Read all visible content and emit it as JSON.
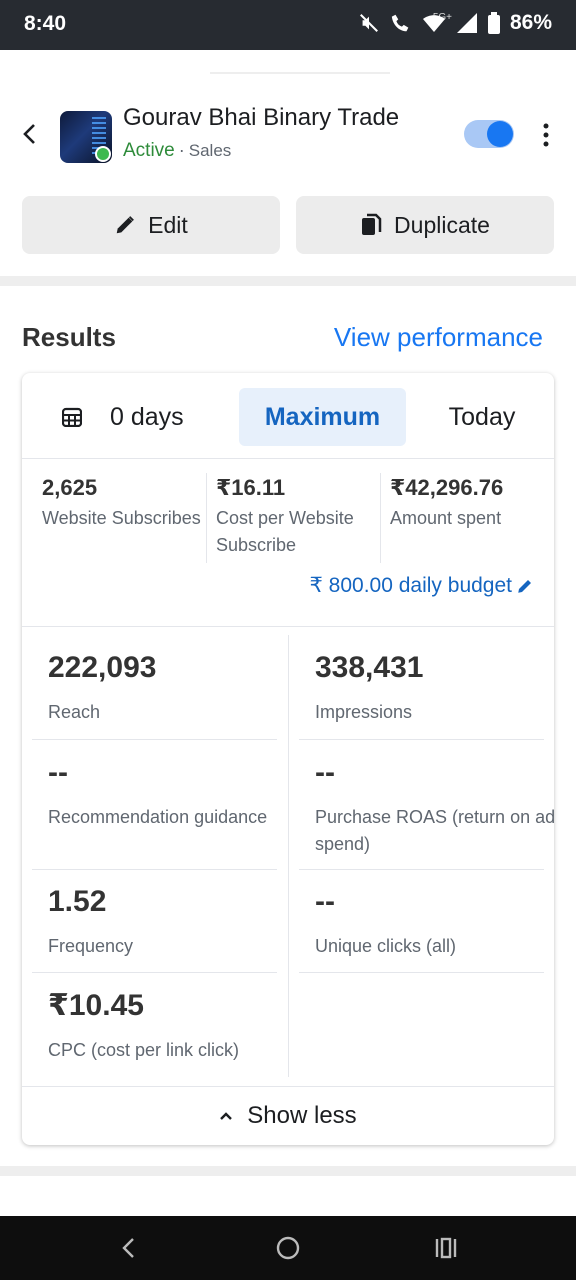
{
  "status_bar": {
    "time": "8:40",
    "network_label": "5G+",
    "battery": "86%"
  },
  "campaign": {
    "title": "Gourav Bhai Binary Trade",
    "status": "Active",
    "separator": "·",
    "objective": "Sales",
    "enabled": true
  },
  "actions": {
    "edit_label": "Edit",
    "duplicate_label": "Duplicate"
  },
  "results": {
    "title": "Results",
    "view_performance": "View performance",
    "date_tabs": [
      "0 days",
      "Maximum",
      "Today"
    ],
    "selected_tab": "Maximum",
    "kpis": [
      {
        "value": "2,625",
        "label": "Website Subscribes"
      },
      {
        "value": "₹16.11",
        "label": "Cost per Website Subscribe"
      },
      {
        "value": "₹42,296.76",
        "label": "Amount spent"
      }
    ],
    "daily_budget": "₹ 800.00 daily budget",
    "metrics": [
      {
        "value": "222,093",
        "label": "Reach"
      },
      {
        "value": "338,431",
        "label": "Impressions"
      },
      {
        "value": "--",
        "label": "Recommendation guidance"
      },
      {
        "value": "--",
        "label": "Purchase ROAS (return on ad spend)"
      },
      {
        "value": "1.52",
        "label": "Frequency"
      },
      {
        "value": "--",
        "label": "Unique clicks (all)"
      },
      {
        "value": "₹10.45",
        "label": "CPC (cost per link click)"
      }
    ],
    "show_less": "Show less"
  },
  "colors": {
    "accent": "#1877f2",
    "active_green": "#2e8b3a",
    "status_bar_bg": "#272b31"
  }
}
